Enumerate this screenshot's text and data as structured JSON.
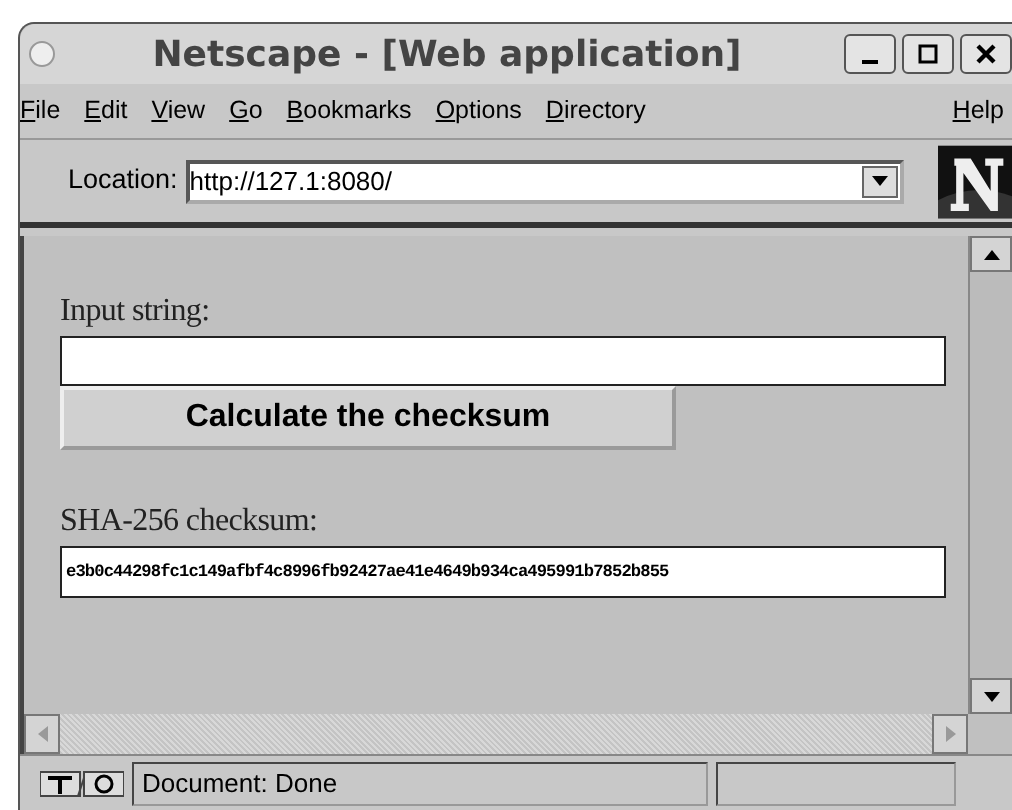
{
  "window": {
    "title": "Netscape - [Web application]"
  },
  "menu": [
    "File",
    "Edit",
    "View",
    "Go",
    "Bookmarks",
    "Options",
    "Directory"
  ],
  "help_menu": "Help",
  "location": {
    "label": "Location:",
    "value": "http://127.1:8080/"
  },
  "content": {
    "input_label": "Input string:",
    "button": "Calculate the checksum",
    "output_label": "SHA-256 checksum:",
    "output_value": "e3b0c44298fc1c149afbf4c8996fb92427ae41e4649b934ca495991b7852b855"
  },
  "status_bar": {
    "text": "Document: Done"
  }
}
